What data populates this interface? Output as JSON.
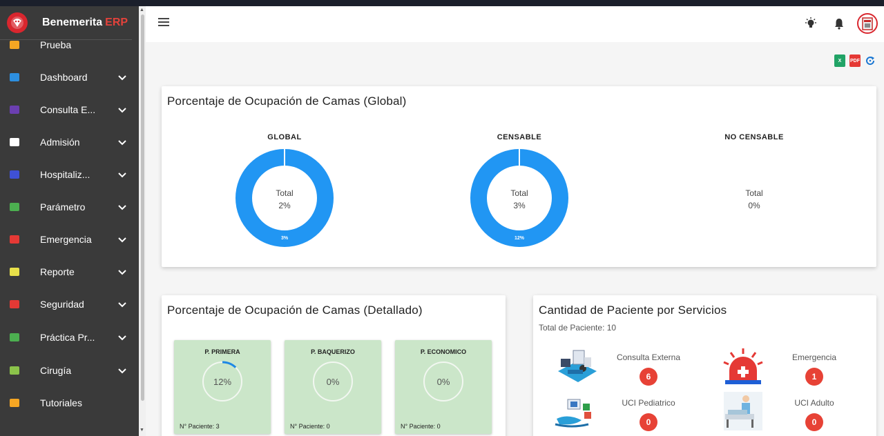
{
  "app": {
    "name": "Benemerita",
    "suffix": "ERP"
  },
  "sidebar": {
    "items": [
      {
        "label": "Prueba",
        "icon": "virus-icon",
        "color": "#f5a623",
        "chevron": false
      },
      {
        "label": "Dashboard",
        "icon": "bar-chart-icon",
        "color": "#2d8fe0",
        "chevron": true
      },
      {
        "label": "Consulta E...",
        "icon": "stethoscope-icon",
        "color": "#6b3fb0",
        "chevron": true
      },
      {
        "label": "Admisión",
        "icon": "id-card-icon",
        "color": "#ffffff",
        "chevron": true
      },
      {
        "label": "Hospitaliz...",
        "icon": "hospital-icon",
        "color": "#3f51d6",
        "chevron": true
      },
      {
        "label": "Parámetro",
        "icon": "gears-icon",
        "color": "#4caf50",
        "chevron": true
      },
      {
        "label": "Emergencia",
        "icon": "ambulance-icon",
        "color": "#e53935",
        "chevron": true
      },
      {
        "label": "Reporte",
        "icon": "report-icon",
        "color": "#e8e04a",
        "chevron": true
      },
      {
        "label": "Seguridad",
        "icon": "shield-icon",
        "color": "#e53935",
        "chevron": true
      },
      {
        "label": "Práctica Pr...",
        "icon": "clipboard-icon",
        "color": "#4caf50",
        "chevron": true
      },
      {
        "label": "Cirugía",
        "icon": "surgeon-icon",
        "color": "#8bc34a",
        "chevron": true
      },
      {
        "label": "Tutoriales",
        "icon": "file-video-icon",
        "color": "#f5a623",
        "chevron": false
      }
    ]
  },
  "global_card": {
    "title": "Porcentaje de Ocupación de Camas (Global)",
    "columns": [
      {
        "label": "GLOBAL",
        "center_label": "Total",
        "center_value": "2%",
        "ring_label": "3%",
        "has_ring": true
      },
      {
        "label": "CENSABLE",
        "center_label": "Total",
        "center_value": "3%",
        "ring_label": "12%",
        "has_ring": true
      },
      {
        "label": "NO CENSABLE",
        "center_label": "Total",
        "center_value": "0%",
        "ring_label": "",
        "has_ring": false
      }
    ]
  },
  "detail_card": {
    "title": "Porcentaje de Ocupación de Camas (Detallado)",
    "items": [
      {
        "title": "P. PRIMERA",
        "value": "12%",
        "progress": 0.12,
        "footer": "N° Paciente: 3"
      },
      {
        "title": "P. BAQUERIZO",
        "value": "0%",
        "progress": 0,
        "footer": "N° Paciente: 0"
      },
      {
        "title": "P. ECONOMICO",
        "value": "0%",
        "progress": 0,
        "footer": "N° Paciente: 0"
      }
    ]
  },
  "services_card": {
    "title": "Cantidad de Paciente por Servicios",
    "subtitle": "Total de Paciente: 10",
    "items": [
      {
        "name": "Consulta Externa",
        "count": "6",
        "icon": "consultation-illustration-icon"
      },
      {
        "name": "Emergencia",
        "count": "1",
        "icon": "emergency-siren-icon"
      },
      {
        "name": "UCI Pediatrico",
        "count": "0",
        "icon": "pediatric-care-icon"
      },
      {
        "name": "UCI Adulto",
        "count": "0",
        "icon": "adult-icu-icon"
      }
    ]
  },
  "export": {
    "excel": "excel-icon",
    "pdf": "PDF",
    "refresh": "refresh-icon"
  },
  "colors": {
    "donut": "#2196f3",
    "badge": "#e74236",
    "mini_card": "#cbe6c9",
    "sidebar": "#3a3a3a"
  }
}
